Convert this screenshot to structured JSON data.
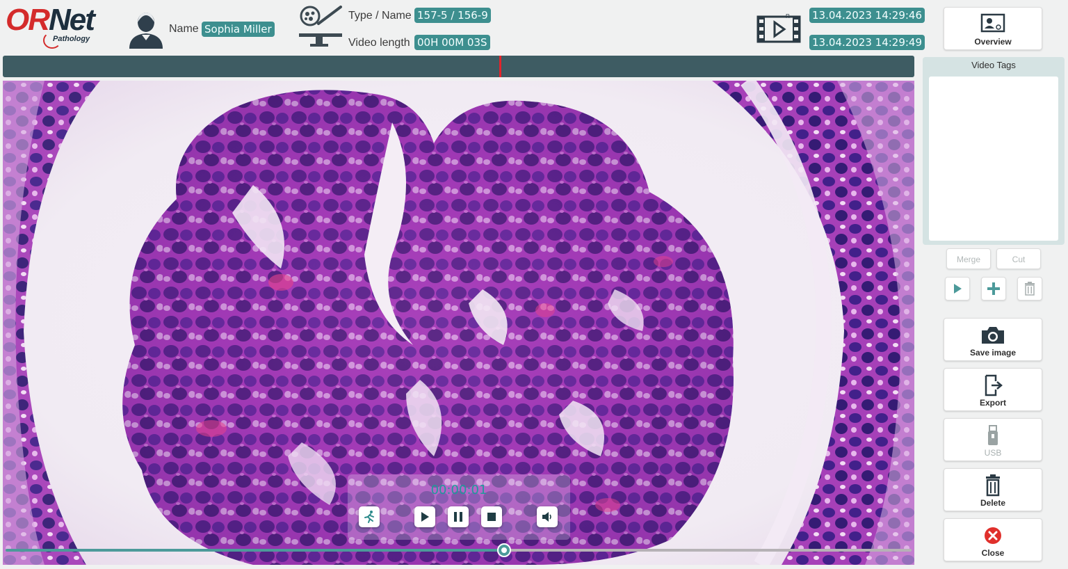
{
  "header": {
    "logo": {
      "brand_o": "O",
      "brand_r": "R",
      "brand_net": "Net",
      "sub": "Pathology"
    },
    "name_label": "Name",
    "name_value": "Sophia Miller",
    "type_label": "Type / Name",
    "type_value": "157-5 / 156-9",
    "length_label": "Video length",
    "length_value": "00H 00M 03S",
    "start_time": "13.04.2023 14:29:46",
    "end_time": "13.04.2023 14:29:49"
  },
  "sidebar": {
    "overview": "Overview",
    "video_tags_title": "Video Tags",
    "merge": "Merge",
    "cut": "Cut",
    "save_image": "Save image",
    "export": "Export",
    "usb": "USB",
    "delete": "Delete",
    "close": "Close"
  },
  "player": {
    "time": "00:00:01",
    "progress": 0.55
  },
  "colors": {
    "accent": "#3d8f8f",
    "timeline": "#3e5c63",
    "marker": "#e3242b",
    "tissue": "#9b2fae"
  }
}
